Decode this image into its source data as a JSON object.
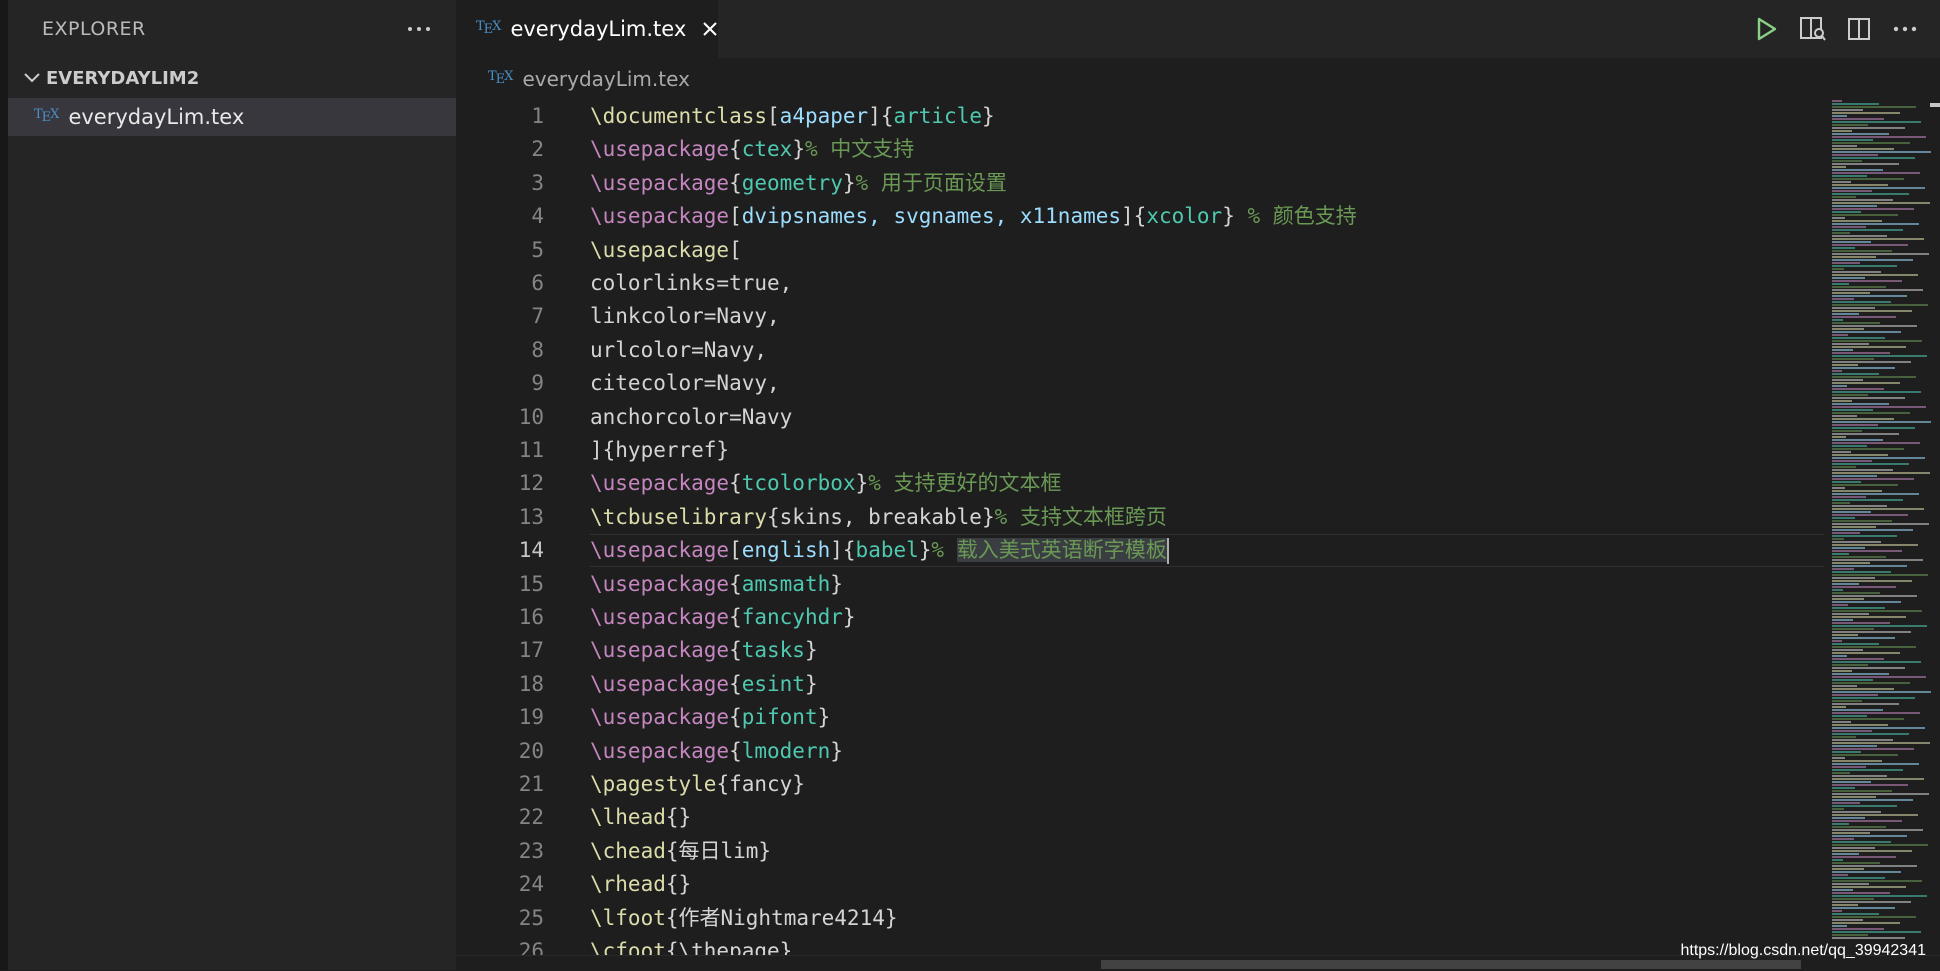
{
  "sidebar": {
    "title": "EXPLORER",
    "folder_name": "EVERYDAYLIM2",
    "files": [
      {
        "name": "everydayLim.tex"
      }
    ]
  },
  "tab": {
    "label": "everydayLim.tex"
  },
  "breadcrumb": {
    "file": "everydayLim.tex"
  },
  "editor": {
    "current_line": 14,
    "lines": [
      {
        "n": "1",
        "tokens": [
          {
            "t": "\\documentclass",
            "c": "#dcdcaa"
          },
          {
            "t": "[",
            "c": "#d4d4d4"
          },
          {
            "t": "a4paper",
            "c": "#9cdcfe"
          },
          {
            "t": "]{",
            "c": "#d4d4d4"
          },
          {
            "t": "article",
            "c": "#4ec9b0"
          },
          {
            "t": "}",
            "c": "#d4d4d4"
          }
        ]
      },
      {
        "n": "2",
        "tokens": [
          {
            "t": "\\usepackage",
            "c": "#c586c0"
          },
          {
            "t": "{",
            "c": "#d4d4d4"
          },
          {
            "t": "ctex",
            "c": "#4ec9b0"
          },
          {
            "t": "}",
            "c": "#d4d4d4"
          },
          {
            "t": "% 中文支持",
            "c": "#6a9955"
          }
        ]
      },
      {
        "n": "3",
        "tokens": [
          {
            "t": "\\usepackage",
            "c": "#c586c0"
          },
          {
            "t": "{",
            "c": "#d4d4d4"
          },
          {
            "t": "geometry",
            "c": "#4ec9b0"
          },
          {
            "t": "}",
            "c": "#d4d4d4"
          },
          {
            "t": "% 用于页面设置",
            "c": "#6a9955"
          }
        ]
      },
      {
        "n": "4",
        "tokens": [
          {
            "t": "\\usepackage",
            "c": "#c586c0"
          },
          {
            "t": "[",
            "c": "#d4d4d4"
          },
          {
            "t": "dvipsnames, svgnames, x11names",
            "c": "#9cdcfe"
          },
          {
            "t": "]{",
            "c": "#d4d4d4"
          },
          {
            "t": "xcolor",
            "c": "#4ec9b0"
          },
          {
            "t": "} ",
            "c": "#d4d4d4"
          },
          {
            "t": "% 颜色支持",
            "c": "#6a9955"
          }
        ]
      },
      {
        "n": "5",
        "tokens": [
          {
            "t": "\\usepackage",
            "c": "#dcdcaa"
          },
          {
            "t": "[",
            "c": "#d4d4d4"
          }
        ]
      },
      {
        "n": "6",
        "tokens": [
          {
            "t": "colorlinks=true,",
            "c": "#d4d4d4"
          }
        ]
      },
      {
        "n": "7",
        "tokens": [
          {
            "t": "linkcolor=Navy,",
            "c": "#d4d4d4"
          }
        ]
      },
      {
        "n": "8",
        "tokens": [
          {
            "t": "urlcolor=Navy,",
            "c": "#d4d4d4"
          }
        ]
      },
      {
        "n": "9",
        "tokens": [
          {
            "t": "citecolor=Navy,",
            "c": "#d4d4d4"
          }
        ]
      },
      {
        "n": "10",
        "tokens": [
          {
            "t": "anchorcolor=Navy",
            "c": "#d4d4d4"
          }
        ]
      },
      {
        "n": "11",
        "tokens": [
          {
            "t": "]{hyperref}",
            "c": "#d4d4d4"
          }
        ]
      },
      {
        "n": "12",
        "tokens": [
          {
            "t": "\\usepackage",
            "c": "#c586c0"
          },
          {
            "t": "{",
            "c": "#d4d4d4"
          },
          {
            "t": "tcolorbox",
            "c": "#4ec9b0"
          },
          {
            "t": "}",
            "c": "#d4d4d4"
          },
          {
            "t": "% 支持更好的文本框",
            "c": "#6a9955"
          }
        ]
      },
      {
        "n": "13",
        "tokens": [
          {
            "t": "\\tcbuselibrary",
            "c": "#dcdcaa"
          },
          {
            "t": "{skins, breakable}",
            "c": "#d4d4d4"
          },
          {
            "t": "% 支持文本框跨页",
            "c": "#6a9955"
          }
        ]
      },
      {
        "n": "14",
        "tokens": [
          {
            "t": "\\usepackage",
            "c": "#c586c0"
          },
          {
            "t": "[",
            "c": "#d4d4d4"
          },
          {
            "t": "english",
            "c": "#9cdcfe"
          },
          {
            "t": "]{",
            "c": "#d4d4d4"
          },
          {
            "t": "babel",
            "c": "#4ec9b0"
          },
          {
            "t": "}",
            "c": "#d4d4d4"
          },
          {
            "t": "% ",
            "c": "#6a9955"
          },
          {
            "t": "载入美式英语断字模板",
            "c": "#6a9955",
            "sel": true
          }
        ]
      },
      {
        "n": "15",
        "tokens": [
          {
            "t": "\\usepackage",
            "c": "#c586c0"
          },
          {
            "t": "{",
            "c": "#d4d4d4"
          },
          {
            "t": "amsmath",
            "c": "#4ec9b0"
          },
          {
            "t": "}",
            "c": "#d4d4d4"
          }
        ]
      },
      {
        "n": "16",
        "tokens": [
          {
            "t": "\\usepackage",
            "c": "#c586c0"
          },
          {
            "t": "{",
            "c": "#d4d4d4"
          },
          {
            "t": "fancyhdr",
            "c": "#4ec9b0"
          },
          {
            "t": "}",
            "c": "#d4d4d4"
          }
        ]
      },
      {
        "n": "17",
        "tokens": [
          {
            "t": "\\usepackage",
            "c": "#c586c0"
          },
          {
            "t": "{",
            "c": "#d4d4d4"
          },
          {
            "t": "tasks",
            "c": "#4ec9b0"
          },
          {
            "t": "}",
            "c": "#d4d4d4"
          }
        ]
      },
      {
        "n": "18",
        "tokens": [
          {
            "t": "\\usepackage",
            "c": "#c586c0"
          },
          {
            "t": "{",
            "c": "#d4d4d4"
          },
          {
            "t": "esint",
            "c": "#4ec9b0"
          },
          {
            "t": "}",
            "c": "#d4d4d4"
          }
        ]
      },
      {
        "n": "19",
        "tokens": [
          {
            "t": "\\usepackage",
            "c": "#c586c0"
          },
          {
            "t": "{",
            "c": "#d4d4d4"
          },
          {
            "t": "pifont",
            "c": "#4ec9b0"
          },
          {
            "t": "}",
            "c": "#d4d4d4"
          }
        ]
      },
      {
        "n": "20",
        "tokens": [
          {
            "t": "\\usepackage",
            "c": "#c586c0"
          },
          {
            "t": "{",
            "c": "#d4d4d4"
          },
          {
            "t": "lmodern",
            "c": "#4ec9b0"
          },
          {
            "t": "}",
            "c": "#d4d4d4"
          }
        ]
      },
      {
        "n": "21",
        "tokens": [
          {
            "t": "\\pagestyle",
            "c": "#dcdcaa"
          },
          {
            "t": "{fancy}",
            "c": "#d4d4d4"
          }
        ]
      },
      {
        "n": "22",
        "tokens": [
          {
            "t": "\\lhead",
            "c": "#dcdcaa"
          },
          {
            "t": "{}",
            "c": "#d4d4d4"
          }
        ]
      },
      {
        "n": "23",
        "tokens": [
          {
            "t": "\\chead",
            "c": "#dcdcaa"
          },
          {
            "t": "{每日lim}",
            "c": "#d4d4d4"
          }
        ]
      },
      {
        "n": "24",
        "tokens": [
          {
            "t": "\\rhead",
            "c": "#dcdcaa"
          },
          {
            "t": "{}",
            "c": "#d4d4d4"
          }
        ]
      },
      {
        "n": "25",
        "tokens": [
          {
            "t": "\\lfoot",
            "c": "#dcdcaa"
          },
          {
            "t": "{作者Nightmare4214}",
            "c": "#d4d4d4"
          }
        ]
      },
      {
        "n": "26",
        "tokens": [
          {
            "t": "\\cfoot",
            "c": "#dcdcaa"
          },
          {
            "t": "{\\thepage}",
            "c": "#d4d4d4"
          }
        ]
      }
    ]
  },
  "icons": {
    "run": "play-icon",
    "preview": "open-preview-icon",
    "split": "split-editor-icon",
    "more": "more-actions-icon"
  },
  "colors": {
    "accent_green": "#89d185",
    "tex_icon": "#4a90c8"
  },
  "watermark": "https://blog.csdn.net/qq_39942341"
}
